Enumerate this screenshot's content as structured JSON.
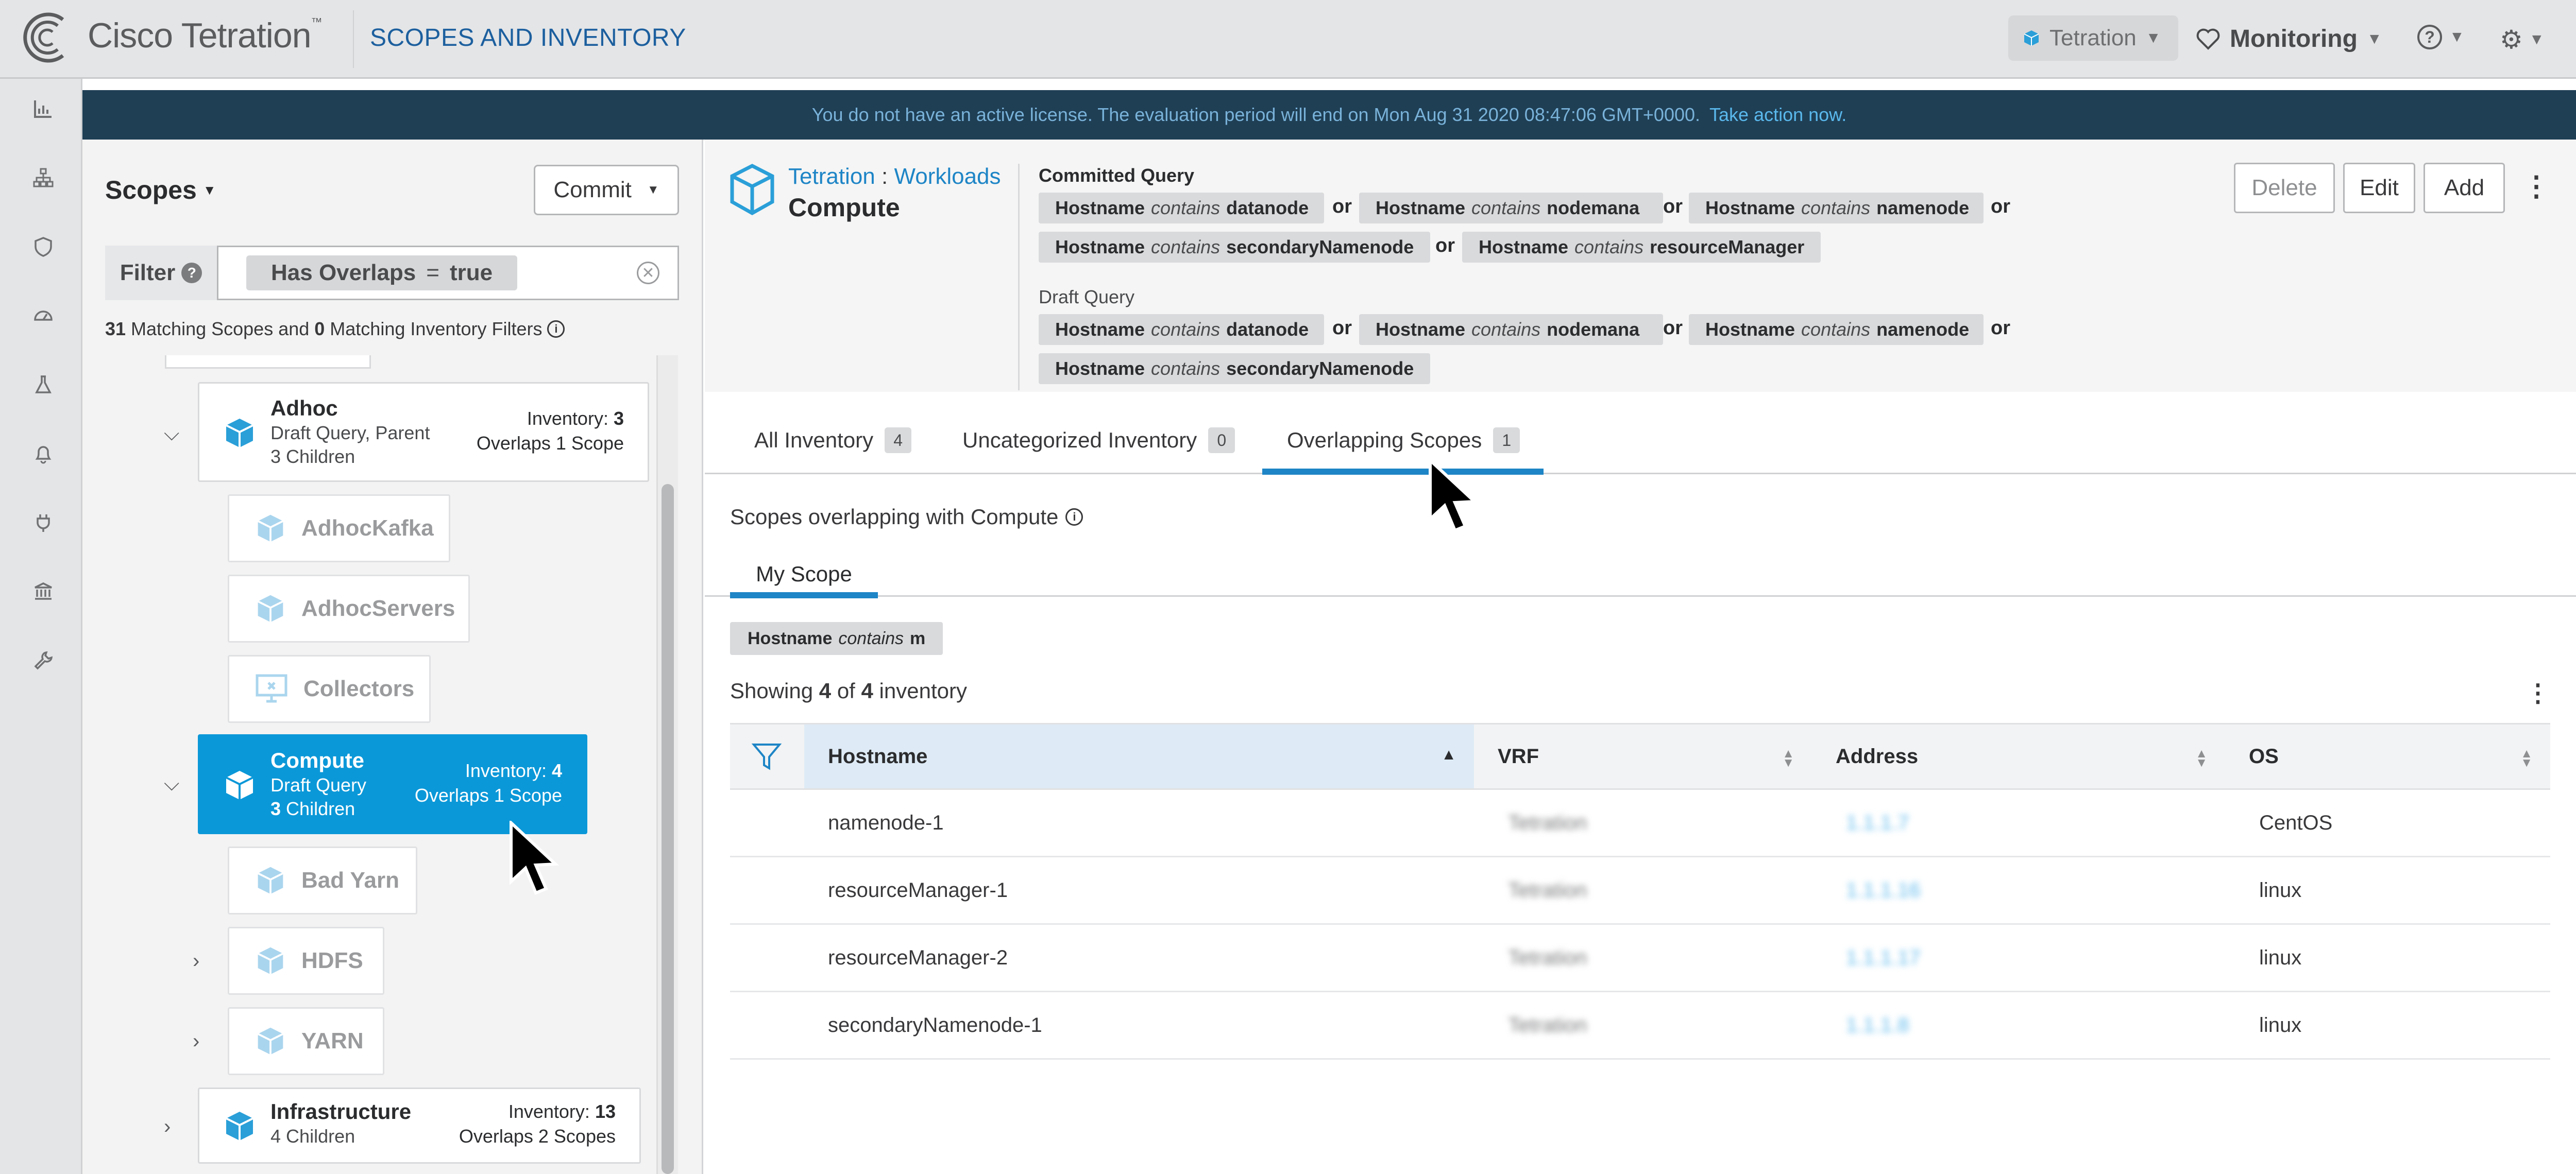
{
  "topbar": {
    "brand": "Cisco Tetration",
    "brand_tm": "™",
    "page_heading": "SCOPES AND INVENTORY",
    "tenant": "Tetration",
    "monitoring": "Monitoring",
    "help_icon": "?"
  },
  "rail": {
    "icons": [
      "chart-icon",
      "hierarchy-icon",
      "shield-icon",
      "dashboard-icon",
      "flask-icon",
      "bell-icon",
      "plug-icon",
      "bank-icon",
      "wrench-icon"
    ]
  },
  "banner": {
    "message": "You do not have an active license. The evaluation period will end on Mon Aug 31 2020 08:47:06 GMT+0000.",
    "link": "Take action now."
  },
  "scopes_panel": {
    "title": "Scopes",
    "commit": "Commit",
    "filter_label": "Filter",
    "filter_token": {
      "field": "Has Overlaps",
      "op": "=",
      "value": "true"
    },
    "summary": {
      "scopes_count": "31",
      "scopes_text": "Matching Scopes and",
      "filters_count": "0",
      "filters_text": "Matching Inventory Filters"
    },
    "tree": {
      "adhoc": {
        "name": "Adhoc",
        "sub1": "Draft Query, Parent",
        "children_count": "3",
        "children_label": "Children",
        "inventory_label": "Inventory:",
        "inventory_value": "3",
        "overlaps": "Overlaps 1 Scope"
      },
      "adhoc_children": [
        "AdhocKafka",
        "AdhocServers",
        "Collectors"
      ],
      "compute": {
        "name": "Compute",
        "sub1": "Draft Query",
        "children_count": "3",
        "children_label": "Children",
        "inventory_label": "Inventory:",
        "inventory_value": "4",
        "overlaps": "Overlaps 1 Scope"
      },
      "compute_children": [
        "Bad Yarn",
        "HDFS",
        "YARN"
      ],
      "infrastructure": {
        "name": "Infrastructure",
        "children_count": "4",
        "children_label": "Children",
        "inventory_label": "Inventory:",
        "inventory_value": "13",
        "overlaps": "Overlaps 2 Scopes"
      }
    }
  },
  "detail": {
    "crumb_root": "Tetration",
    "crumb_sep": ":",
    "crumb_leaf": "Workloads",
    "scope_title": "Compute",
    "committed_heading": "Committed Query",
    "draft_heading": "Draft Query",
    "or": "or",
    "committed": [
      {
        "field": "Hostname",
        "op": "contains",
        "value": "datanode"
      },
      {
        "field": "Hostname",
        "op": "contains",
        "value": "nodemana"
      },
      {
        "field": "Hostname",
        "op": "contains",
        "value": "namenode"
      },
      {
        "field": "Hostname",
        "op": "contains",
        "value": "secondaryNamenode"
      },
      {
        "field": "Hostname",
        "op": "contains",
        "value": "resourceManager"
      }
    ],
    "draft": [
      {
        "field": "Hostname",
        "op": "contains",
        "value": "datanode"
      },
      {
        "field": "Hostname",
        "op": "contains",
        "value": "nodemana"
      },
      {
        "field": "Hostname",
        "op": "contains",
        "value": "namenode"
      },
      {
        "field": "Hostname",
        "op": "contains",
        "value": "secondaryNamenode"
      }
    ],
    "buttons": {
      "delete": "Delete",
      "edit": "Edit",
      "add": "Add"
    },
    "tabs": [
      {
        "label": "All Inventory",
        "count": "4"
      },
      {
        "label": "Uncategorized Inventory",
        "count": "0"
      },
      {
        "label": "Overlapping Scopes",
        "count": "1"
      }
    ],
    "overlap_heading": "Scopes overlapping with Compute",
    "subtab": "My Scope",
    "overlap_token": {
      "field": "Hostname",
      "op": "contains",
      "value": "m"
    },
    "showing": {
      "prefix": "Showing",
      "shown": "4",
      "of": "of",
      "total": "4",
      "suffix": "inventory"
    },
    "table": {
      "columns": [
        "Hostname",
        "VRF",
        "Address",
        "OS"
      ],
      "rows": [
        {
          "hostname": "namenode-1",
          "vrf": "Tetration",
          "address": "1.1.1.7",
          "os": "CentOS"
        },
        {
          "hostname": "resourceManager-1",
          "vrf": "Tetration",
          "address": "1.1.1.16",
          "os": "linux"
        },
        {
          "hostname": "resourceManager-2",
          "vrf": "Tetration",
          "address": "1.1.1.17",
          "os": "linux"
        },
        {
          "hostname": "secondaryNamenode-1",
          "vrf": "Tetration",
          "address": "1.1.1.8",
          "os": "linux"
        }
      ]
    }
  },
  "colors": {
    "accent": "#1e85c6",
    "selected": "#0b98d8",
    "banner_bg": "#1f3f55"
  }
}
